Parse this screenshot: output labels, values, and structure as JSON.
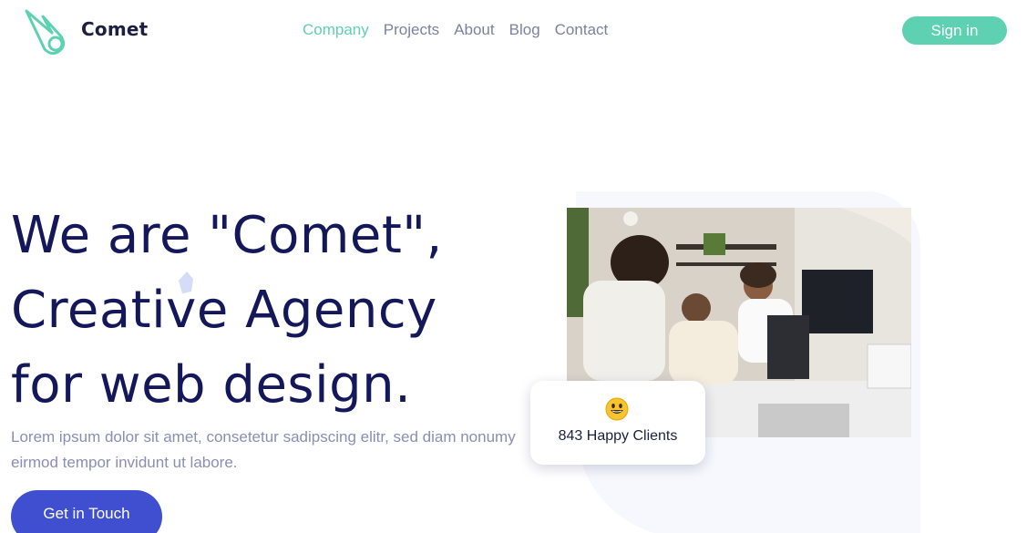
{
  "brand": {
    "name": "Comet",
    "icon": "comet-logo-icon",
    "accent": "#5ed1b3"
  },
  "nav": {
    "items": [
      {
        "label": "Company",
        "active": true
      },
      {
        "label": "Projects",
        "active": false
      },
      {
        "label": "About",
        "active": false
      },
      {
        "label": "Blog",
        "active": false
      },
      {
        "label": "Contact",
        "active": false
      }
    ],
    "active_color": "#5ed1b3",
    "inactive_color": "#7d81a0"
  },
  "header": {
    "signin_label": "Sign in"
  },
  "hero": {
    "title_lines": [
      "We are \"Comet\",",
      "Creative Agency",
      "for web design."
    ],
    "subtitle": "Lorem ipsum dolor sit amet, consetetur sadipscing elitr, sed diam nonumy eirmod tempor invidunt ut labore.",
    "cta_label": "Get in Touch",
    "cta_color": "#3f4fcf",
    "title_color": "#14185a"
  },
  "stat_card": {
    "emoji_icon": "grinning-face-icon",
    "text": "843 Happy Clients"
  }
}
